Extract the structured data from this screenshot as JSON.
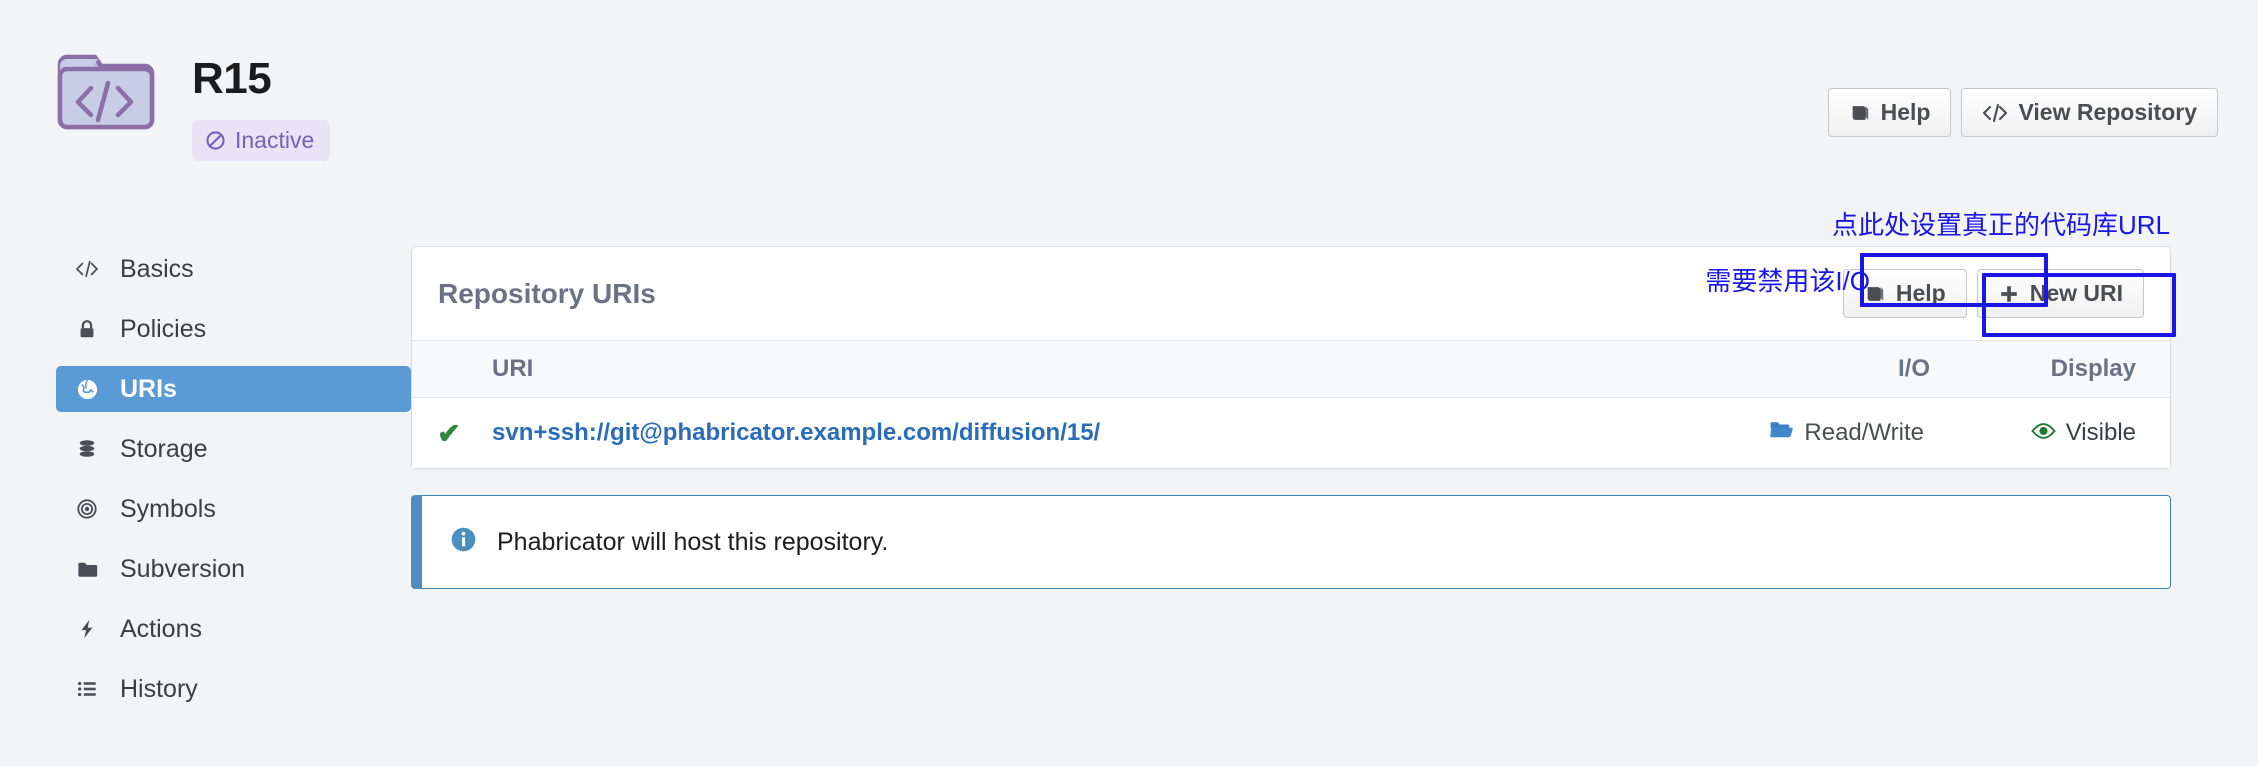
{
  "header": {
    "repo_title": "R15",
    "status_label": "Inactive",
    "icon_name": "repository-folder-code-icon",
    "actions": [
      {
        "label": "Help",
        "icon": "book-icon"
      },
      {
        "label": "View Repository",
        "icon": "code-brackets-icon"
      }
    ]
  },
  "sidebar": {
    "items": [
      {
        "label": "Basics",
        "icon": "code-brackets-icon",
        "active": false
      },
      {
        "label": "Policies",
        "icon": "lock-icon",
        "active": false
      },
      {
        "label": "URIs",
        "icon": "globe-icon",
        "active": true
      },
      {
        "label": "Storage",
        "icon": "database-icon",
        "active": false
      },
      {
        "label": "Symbols",
        "icon": "target-icon",
        "active": false
      },
      {
        "label": "Subversion",
        "icon": "folder-icon",
        "active": false
      },
      {
        "label": "Actions",
        "icon": "bolt-icon",
        "active": false
      },
      {
        "label": "History",
        "icon": "list-icon",
        "active": false
      }
    ]
  },
  "panel": {
    "title": "Repository URIs",
    "actions": [
      {
        "label": "Help",
        "icon": "book-icon"
      },
      {
        "label": "New URI",
        "icon": "plus-icon"
      }
    ],
    "table": {
      "columns": [
        "",
        "URI",
        "I/O",
        "Display"
      ],
      "rows": [
        {
          "enabled_icon": "check-icon",
          "uri": "svn+ssh://git@phabricator.example.com/diffusion/15/",
          "io": {
            "label": "Read/Write",
            "icon": "open-folder-icon"
          },
          "display": {
            "label": "Visible",
            "icon": "eye-icon"
          }
        }
      ]
    }
  },
  "notice": {
    "icon": "info-circle-icon",
    "text": "Phabricator will host this repository."
  },
  "annotations": [
    {
      "text": "点此处设置真正的代码库URL",
      "target": "new-uri-button"
    },
    {
      "text": "需要禁用该I/O",
      "target": "read-write-button"
    }
  ],
  "colors": {
    "accent_blue": "#5b9bd5",
    "link_blue": "#2b6cb8",
    "annotation_blue": "#1a16e8",
    "status_purple": "#7562ba",
    "status_bg": "#e8e4f5",
    "check_green": "#2e8b3d",
    "notice_border": "#4a8fc0",
    "page_bg": "#f2f4f6"
  }
}
